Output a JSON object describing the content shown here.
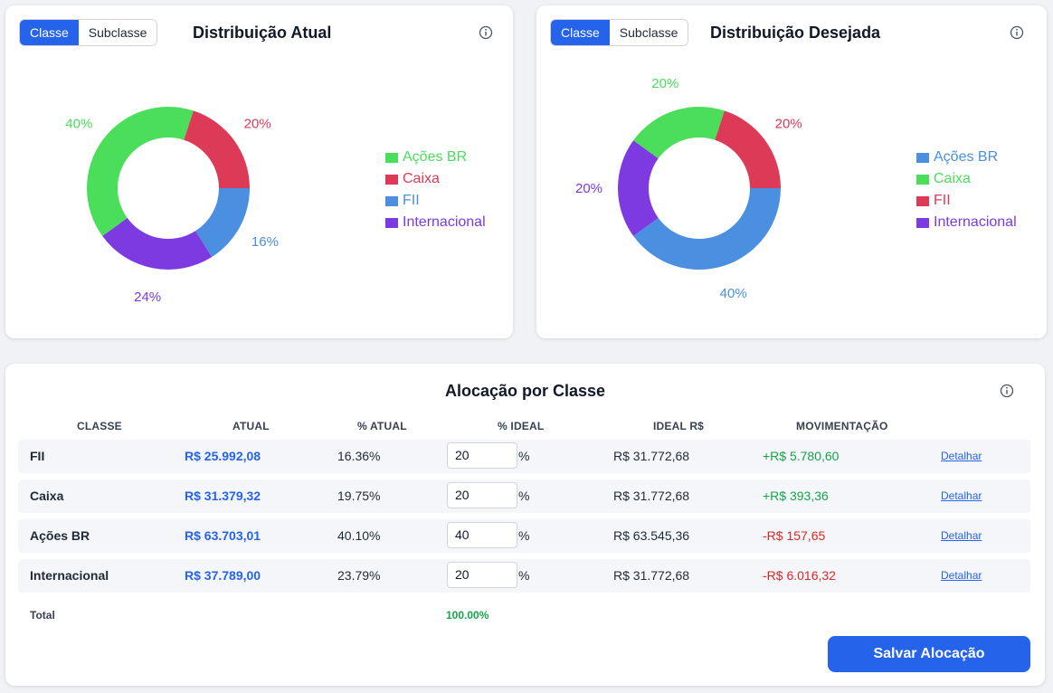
{
  "colors": {
    "acoes_br": "#4ade5a",
    "caixa": "#dc3a56",
    "fii": "#4a8fe0",
    "internacional": "#7c3ae0",
    "primary": "#2563eb",
    "positive": "#16a34a",
    "negative": "#dc2626"
  },
  "atual_card": {
    "toggle": {
      "classe": "Classe",
      "subclasse": "Subclasse"
    },
    "title": "Distribuição Atual",
    "info_icon": "info-icon",
    "legend": [
      "Ações BR",
      "Caixa",
      "FII",
      "Internacional"
    ]
  },
  "desejada_card": {
    "toggle": {
      "classe": "Classe",
      "subclasse": "Subclasse"
    },
    "title": "Distribuição Desejada",
    "info_icon": "info-icon",
    "legend": [
      "Ações BR",
      "Caixa",
      "FII",
      "Internacional"
    ]
  },
  "chart_data": [
    {
      "type": "pie",
      "title": "Distribuição Atual",
      "categories": [
        "FII",
        "Internacional",
        "Ações BR",
        "Caixa"
      ],
      "values": [
        16,
        24,
        40,
        20
      ],
      "labels": [
        "16%",
        "24%",
        "40%",
        "20%"
      ],
      "legend": "right"
    },
    {
      "type": "pie",
      "title": "Distribuição Desejada",
      "categories": [
        "FII",
        "Internacional",
        "Ações BR",
        "Caixa"
      ],
      "values": [
        40,
        20,
        20,
        20
      ],
      "labels": [
        "40%",
        "20%",
        "20%",
        "20%"
      ],
      "legend": "right"
    }
  ],
  "alocacao": {
    "title": "Alocação por Classe",
    "info_icon": "info-icon",
    "headers": {
      "classe": "CLASSE",
      "atual": "ATUAL",
      "pct_atual": "% ATUAL",
      "pct_ideal": "% IDEAL",
      "ideal": "IDEAL R$",
      "movimentacao": "MOVIMENTAÇÃO"
    },
    "rows": [
      {
        "classe": "FII",
        "atual": "R$ 25.992,08",
        "pct_atual": "16.36%",
        "ideal_input": "20",
        "pct_sign": "%",
        "ideal": "R$ 31.772,68",
        "movimentacao": "+R$ 5.780,60",
        "detalhar": "Detalhar"
      },
      {
        "classe": "Caixa",
        "atual": "R$ 31.379,32",
        "pct_atual": "19.75%",
        "ideal_input": "20",
        "pct_sign": "%",
        "ideal": "R$ 31.772,68",
        "movimentacao": "+R$ 393,36",
        "detalhar": "Detalhar"
      },
      {
        "classe": "Ações BR",
        "atual": "R$ 63.703,01",
        "pct_atual": "40.10%",
        "ideal_input": "40",
        "pct_sign": "%",
        "ideal": "R$ 63.545,36",
        "movimentacao": "-R$ 157,65",
        "detalhar": "Detalhar"
      },
      {
        "classe": "Internacional",
        "atual": "R$ 37.789,00",
        "pct_atual": "23.79%",
        "ideal_input": "20",
        "pct_sign": "%",
        "ideal": "R$ 31.772,68",
        "movimentacao": "-R$ 6.016,32",
        "detalhar": "Detalhar"
      }
    ],
    "total_label": "Total",
    "total_value": "100.00%",
    "save_button": "Salvar Alocação"
  }
}
